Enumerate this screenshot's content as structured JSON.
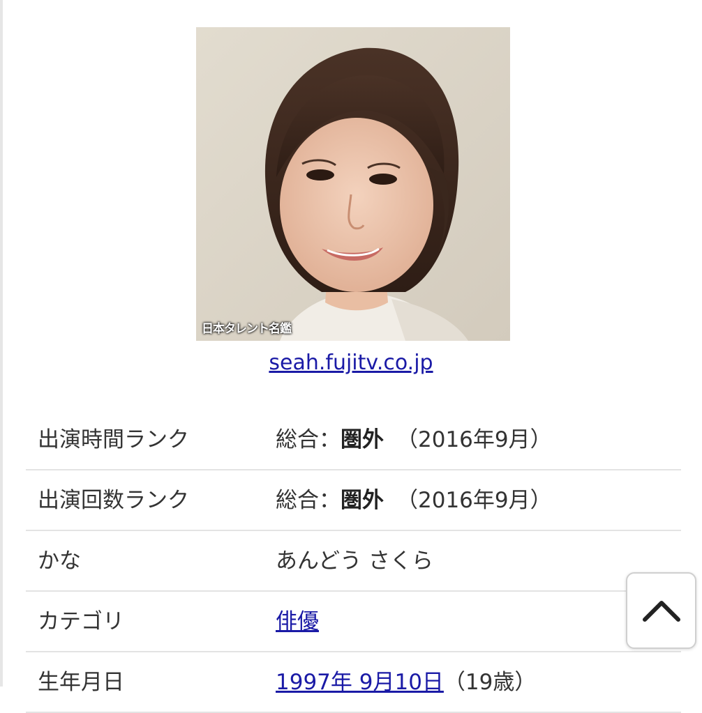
{
  "profile": {
    "photo_watermark": "日本タレント名鑑",
    "source_link_text": "seah.fujitv.co.jp"
  },
  "info_rows": [
    {
      "label": "出演時間ランク",
      "value_prefix": "総合：",
      "value_bold": "圏外",
      "value_suffix": "（2016年9月）"
    },
    {
      "label": "出演回数ランク",
      "value_prefix": "総合：",
      "value_bold": "圏外",
      "value_suffix": "（2016年9月）"
    },
    {
      "label": "かな",
      "value": "あんどう さくら"
    },
    {
      "label": "カテゴリ",
      "value_link": "俳優"
    },
    {
      "label": "生年月日",
      "value_link": "1997年 9月10日",
      "value_suffix": "（19歳）"
    }
  ],
  "back_to_top": {
    "icon": "chevron-up-icon"
  },
  "colors": {
    "link": "#1a1aa6",
    "text": "#333333",
    "divider": "#e3e3e3",
    "photo_background": "#dcd5c9"
  }
}
